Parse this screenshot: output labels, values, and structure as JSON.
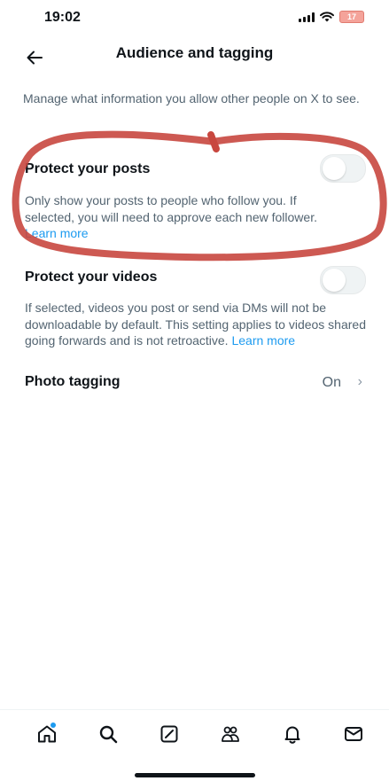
{
  "status_bar": {
    "time": "19:02",
    "battery": "17"
  },
  "header": {
    "title": "Audience and tagging"
  },
  "intro_text": "Manage what information you allow other people on X to see.",
  "settings": {
    "protect_posts": {
      "title": "Protect your posts",
      "description": "Only show your posts to people who follow you. If selected, you will need to approve each new follower.",
      "link": "Learn more",
      "enabled": false
    },
    "protect_videos": {
      "title": "Protect your videos",
      "description": "If selected, videos you post or send via DMs will not be downloadable by default. This setting applies to videos shared going forwards and is not retroactive.",
      "link": "Learn more",
      "enabled": false
    },
    "photo_tagging": {
      "title": "Photo tagging",
      "value": "On"
    }
  },
  "bottom_nav": {
    "items": [
      "home-icon",
      "search-icon",
      "grok-icon",
      "communities-icon",
      "notifications-icon",
      "messages-icon"
    ]
  },
  "colors": {
    "accent": "#1d9bf0",
    "annotation": "#c8473f",
    "secondary_text": "#536471"
  }
}
